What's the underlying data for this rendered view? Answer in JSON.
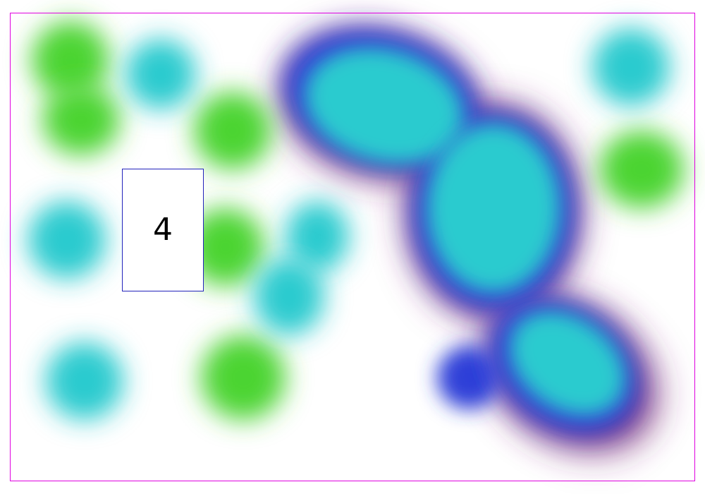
{
  "canvas": {
    "background": "#ffffff",
    "frame_color": "#e000e0"
  },
  "palette": {
    "green": "#4cd432",
    "cyan": "#2ccbcf",
    "blue": "#2e3fd8",
    "purple": "#7b2d7a"
  },
  "card": {
    "label": "4",
    "border_color": "#2222bb"
  }
}
